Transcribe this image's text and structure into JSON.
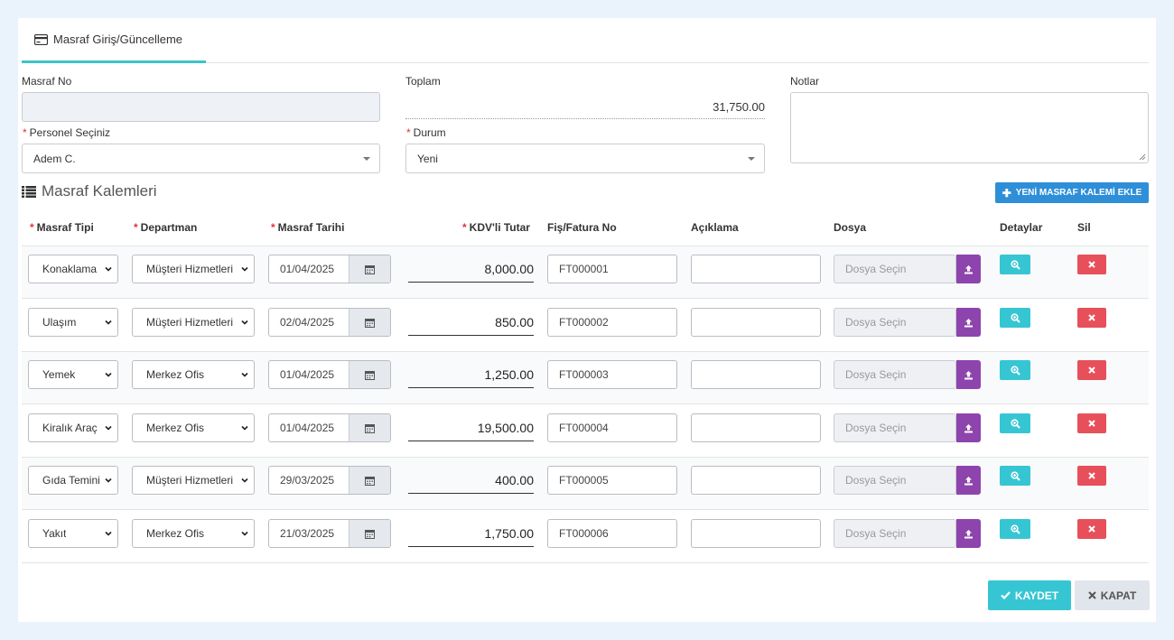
{
  "tab": {
    "title": "Masraf Giriş/Güncelleme",
    "icon": "credit-card-icon"
  },
  "form": {
    "masraf_no_label": "Masraf No",
    "masraf_no_value": "",
    "toplam_label": "Toplam",
    "toplam_value": "31,750.00",
    "notlar_label": "Notlar",
    "notlar_value": "",
    "personel_label": "Personel Seçiniz",
    "personel_value": "Adem C.",
    "durum_label": "Durum",
    "durum_value": "Yeni",
    "required_mark": "*"
  },
  "section": {
    "title": "Masraf Kalemleri",
    "icon": "list-icon",
    "add_button": "YENİ MASRAF KALEMİ EKLE"
  },
  "table": {
    "headers": {
      "masraf_tipi": "Masraf Tipi",
      "departman": "Departman",
      "masraf_tarihi": "Masraf Tarihi",
      "tutar": "KDV'li Tutar",
      "fis_no": "Fiş/Fatura No",
      "aciklama": "Açıklama",
      "dosya": "Dosya",
      "detaylar": "Detaylar",
      "sil": "Sil"
    },
    "file_placeholder": "Dosya Seçin",
    "rows": [
      {
        "tip": "Konaklama",
        "departman": "Müşteri Hizmetleri",
        "tarih": "01/04/2025",
        "tutar": "8,000.00",
        "fis": "FT000001",
        "aciklama": ""
      },
      {
        "tip": "Ulaşım",
        "departman": "Müşteri Hizmetleri",
        "tarih": "02/04/2025",
        "tutar": "850.00",
        "fis": "FT000002",
        "aciklama": ""
      },
      {
        "tip": "Yemek",
        "departman": "Merkez Ofis",
        "tarih": "01/04/2025",
        "tutar": "1,250.00",
        "fis": "FT000003",
        "aciklama": ""
      },
      {
        "tip": "Kiralık Araç",
        "departman": "Merkez Ofis",
        "tarih": "01/04/2025",
        "tutar": "19,500.00",
        "fis": "FT000004",
        "aciklama": ""
      },
      {
        "tip": "Gıda Temini",
        "departman": "Müşteri Hizmetleri",
        "tarih": "29/03/2025",
        "tutar": "400.00",
        "fis": "FT000005",
        "aciklama": ""
      },
      {
        "tip": "Yakıt",
        "departman": "Merkez Ofis",
        "tarih": "21/03/2025",
        "tutar": "1,750.00",
        "fis": "FT000006",
        "aciklama": ""
      }
    ]
  },
  "footer": {
    "save": "KAYDET",
    "close": "KAPAT"
  },
  "colors": {
    "accent": "#3cc3c9",
    "primary": "#2e8fd8",
    "info": "#36c6d3",
    "danger": "#e7505a",
    "purple": "#8e44ad",
    "required": "#e0303e"
  }
}
